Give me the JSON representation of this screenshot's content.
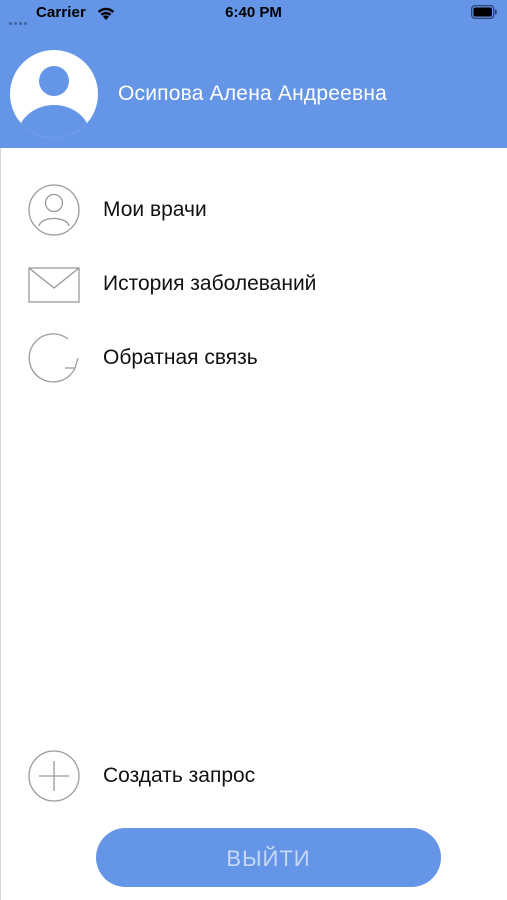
{
  "status_bar": {
    "carrier": "Carrier",
    "time": "6:40 PM"
  },
  "header": {
    "user_name": "Осипова Алена Андреевна",
    "background_color": "#6595e6"
  },
  "menu": {
    "items": [
      {
        "label": "Мои врачи",
        "icon": "user-circle-icon"
      },
      {
        "label": "История заболеваний",
        "icon": "envelope-icon"
      },
      {
        "label": "Обратная связь",
        "icon": "refresh-icon"
      }
    ],
    "create_request": {
      "label": "Создать запрос",
      "icon": "plus-circle-icon"
    }
  },
  "logout": {
    "label": "ВЫЙТИ",
    "color": "#6595e6"
  }
}
